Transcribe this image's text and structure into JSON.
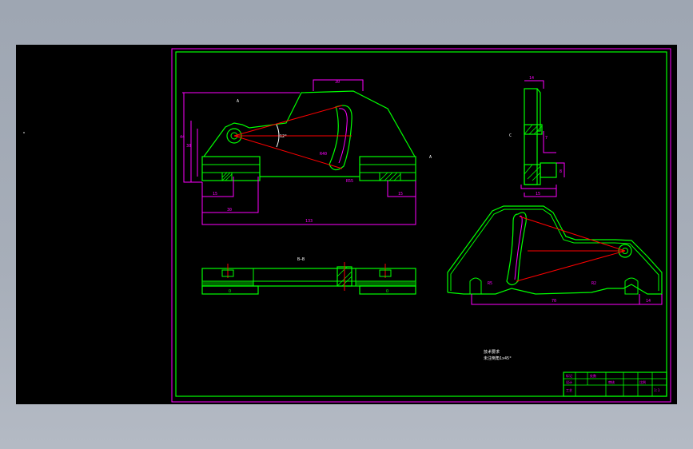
{
  "colors": {
    "background": "#9ea6b2",
    "canvas": "#000000",
    "outline": "#00ff00",
    "dimension": "#ff00ff",
    "centerline": "#ff0000",
    "annotation": "#ffffff",
    "hatch": "#00cc00"
  },
  "drawing": {
    "front_view": {
      "dim_top_width": "30",
      "dim_overall_length": "133",
      "dim_left_offset": "15",
      "dim_base_width": "30",
      "dim_bottom_right": "15",
      "dim_left_height_a": "44",
      "dim_left_height_b": "30",
      "angle_label": "12°",
      "slot_radius": "R40",
      "slot_note": "R55"
    },
    "side_view": {
      "dim_top": "14",
      "dim_side": "7",
      "dim_base": "15",
      "dim_right": "8"
    },
    "section_view": {
      "label": "B—B",
      "left_block": "O",
      "right_block": "O"
    },
    "iso_view": {
      "dim_bottom": "70",
      "dim_right": "14",
      "dim_r1": "R5",
      "dim_r2": "R2"
    },
    "notes": {
      "title": "技术要求",
      "line1": "未注倒角1x45°"
    },
    "title_block": {
      "cell1": "标记",
      "cell2": "处数",
      "cell3": "设计",
      "cell4": "审核",
      "cell5": "工艺",
      "cell6": "比例",
      "cell7": "1:1"
    }
  }
}
